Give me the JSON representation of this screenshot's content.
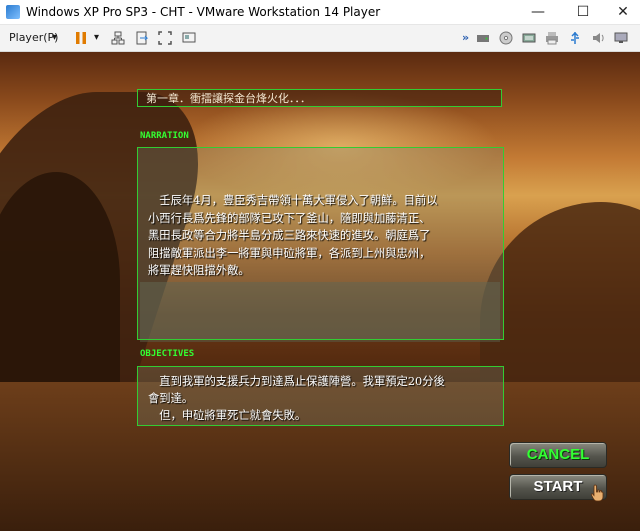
{
  "window": {
    "title": "Windows XP Pro SP3 - CHT - VMware Workstation 14 Player",
    "minimize": "—",
    "maximize": "☐",
    "close": "✕"
  },
  "toolbar": {
    "player_menu": "Player(P)",
    "player_dropdown": "▾",
    "pause_dropdown": "▾",
    "overflow": "»"
  },
  "game": {
    "chapter_title": "第一章．衝擂讓探金台烽火化．．．",
    "narration_label": "NARRATION",
    "narration_lines": [
      "　壬辰年4月，豊臣秀吉帶領十萬大軍侵入了朝鮮。目前以",
      "小西行長爲先鋒的部隊已攻下了釜山，隨即與加藤清正、",
      "黑田長政等合力將半島分成三路來快速的進攻。朝庭爲了",
      "阻擋敵軍派出李一將軍與申砬將軍，各派到上州與忠州，",
      "將軍趕快阻擋外敵。"
    ],
    "objectives_label": "OBJECTIVES",
    "objective_lines": [
      "　直到我軍的支援兵力到達爲止保護陣營。我軍預定20分後",
      "會到達。",
      "　但，申砬將軍死亡就會失敗。"
    ],
    "cancel_label": "CANCEL",
    "start_label": "START"
  },
  "colors": {
    "accent_green": "#33ff33",
    "panel_border": "#33cc33"
  }
}
